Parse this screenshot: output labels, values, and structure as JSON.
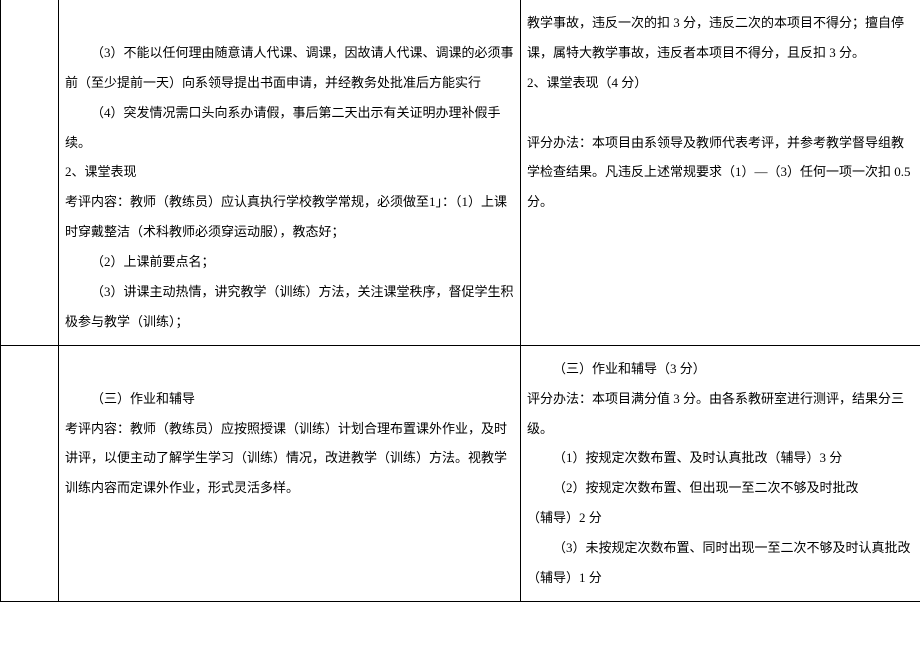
{
  "row1": {
    "left": {
      "p1": "（3）不能以任何理由随意请人代课、调课，因故请人代课、调课的必须事前（至少提前一天）向系领导提出书面申请，并经教务处批准后方能实行",
      "p2": "（4）突发情况需口头向系办请假，事后第二天出示有关证明办理补假手续。",
      "p3": "2、课堂表现",
      "p4": "考评内容：教师（教练员）应认真执行学校教学常规，必须做至1」：（1）上课时穿戴整洁（术科教师必须穿运动服），教态好；",
      "p5": "（2）上课前要点名；",
      "p6": "（3）讲课主动热情，讲究教学（训练）方法，关注课堂秩序，督促学生积极参与教学（训练）；"
    },
    "right": {
      "p1": "教学事故，违反一次的扣 3 分，违反二次的本项目不得分；擅自停课，属特大教学事故，违反者本项目不得分，且反扣 3 分。",
      "p2": "2、课堂表现（4 分）",
      "p3": "评分办法：本项目由系领导及教师代表考评，并参考教学督导组教学检查结果。凡违反上述常规要求（1）―（3）任何一项一次扣 0.5 分。"
    }
  },
  "row2": {
    "left": {
      "p1": "（三）作业和辅导",
      "p2": "考评内容：教师（教练员）应按照授课（训练）计划合理布置课外作业，及时讲评，以便主动了解学生学习（训练）情况，改进教学（训练）方法。视教学训练内容而定课外作业，形式灵活多样。"
    },
    "right": {
      "p1": "（三）作业和辅导（3 分）",
      "p2": "评分办法：本项目满分值 3 分。由各系教研室进行测评，结果分三级。",
      "p3": "（1）按规定次数布置、及时认真批改（辅导）3 分",
      "p4": "（2）按规定次数布置、但出现一至二次不够及时批改",
      "p5": "（辅导）2 分",
      "p6": "（3）未按规定次数布置、同时出现一至二次不够及时认真批改（辅导）1 分"
    }
  }
}
